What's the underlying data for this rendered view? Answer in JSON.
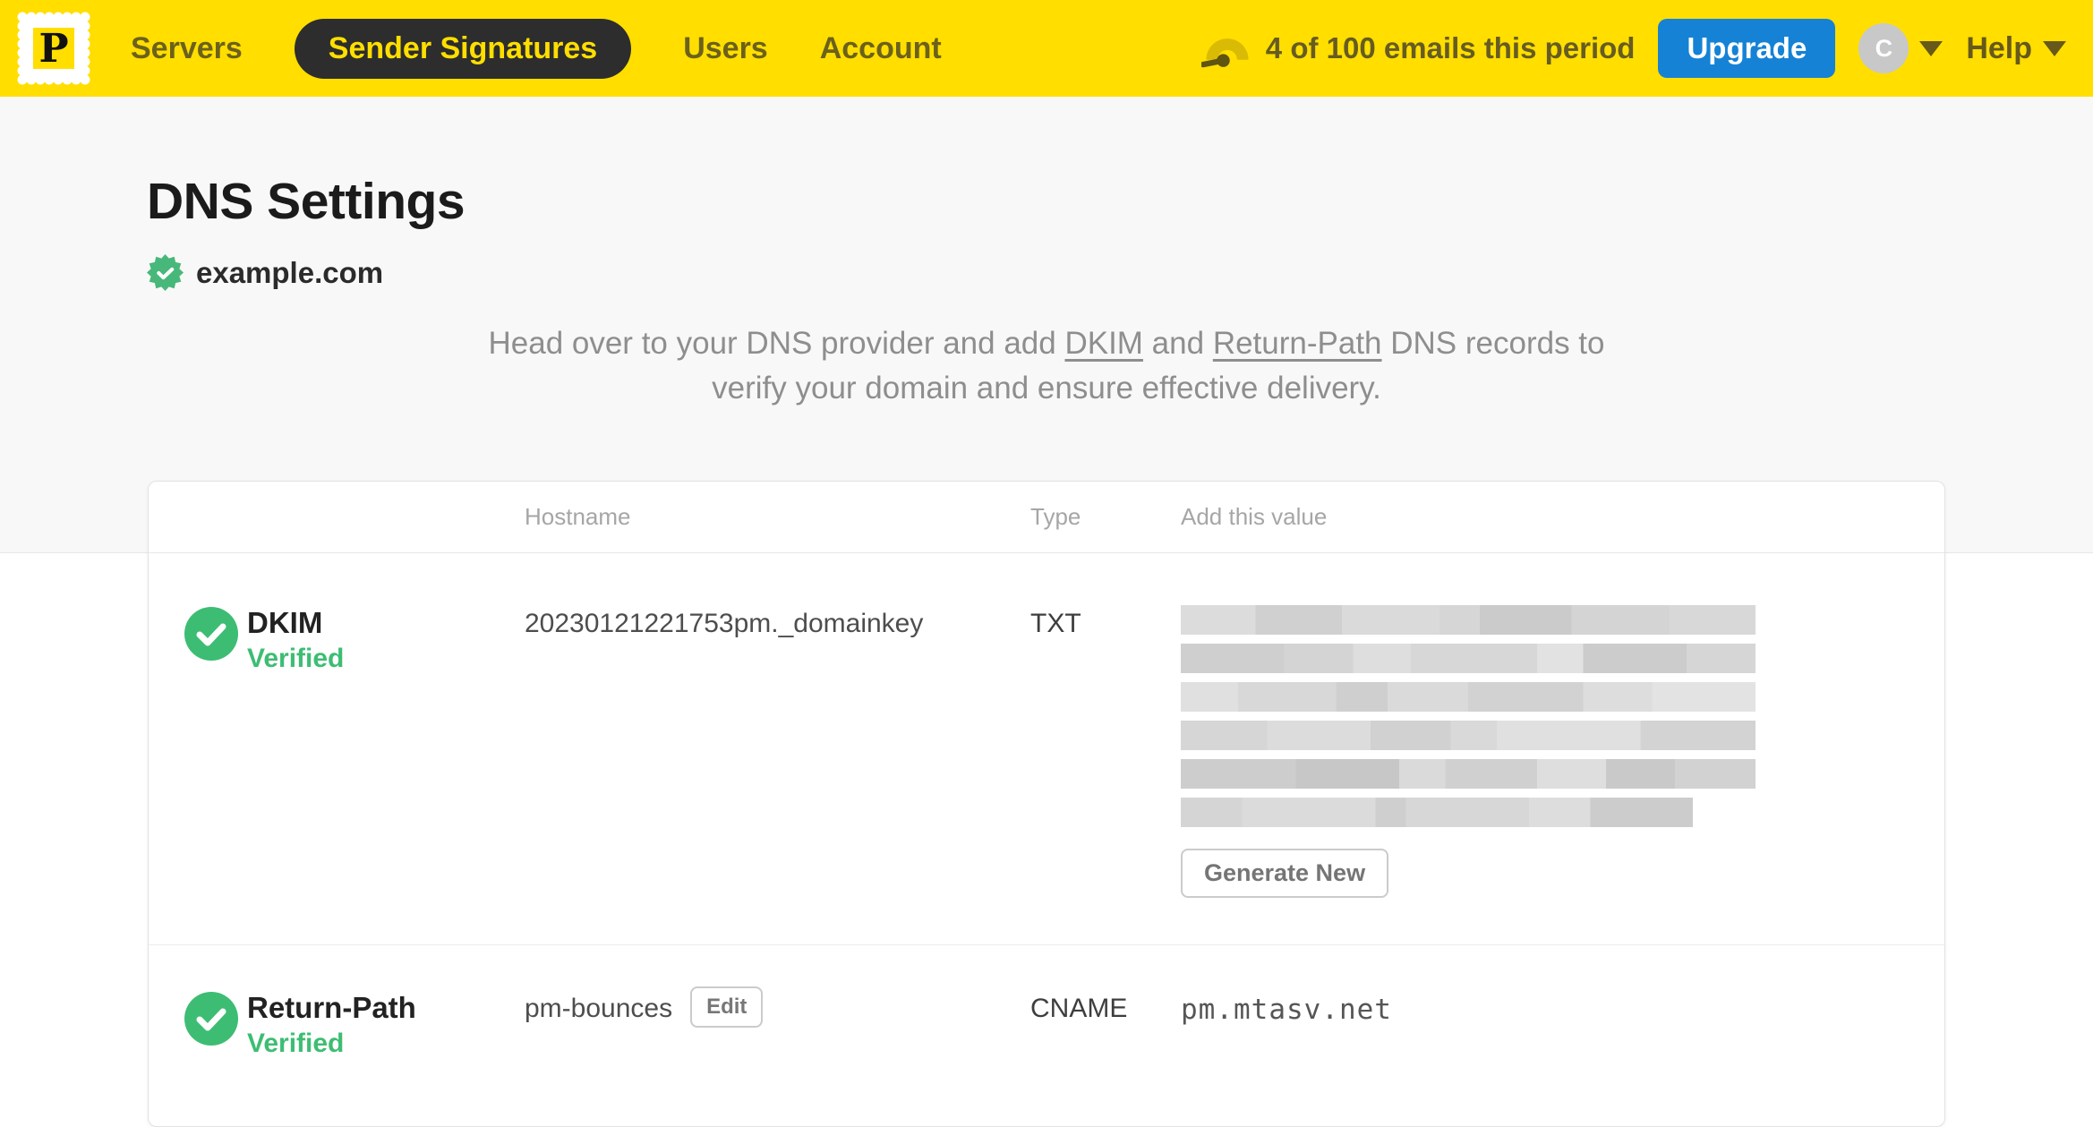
{
  "nav": {
    "logo_letter": "P",
    "items": [
      {
        "label": "Servers",
        "active": false
      },
      {
        "label": "Sender Signatures",
        "active": true
      },
      {
        "label": "Users",
        "active": false
      },
      {
        "label": "Account",
        "active": false
      }
    ],
    "usage_text": "4 of 100 emails this period",
    "upgrade_label": "Upgrade",
    "avatar_initial": "C",
    "help_label": "Help"
  },
  "page": {
    "title": "DNS Settings",
    "domain": "example.com",
    "intro": {
      "p1": "Head over to your DNS provider and add ",
      "link_dkim": "DKIM",
      "p2": " and ",
      "link_return_path": "Return-Path",
      "p3": " DNS records to verify your domain and ensure effective delivery."
    }
  },
  "table": {
    "headers": {
      "hostname": "Hostname",
      "type": "Type",
      "value": "Add this value"
    },
    "rows": [
      {
        "name": "DKIM",
        "status": "Verified",
        "hostname": "20230121221753pm._domainkey",
        "type": "TXT",
        "value_redacted": true,
        "action_label": "Generate New"
      },
      {
        "name": "Return-Path",
        "status": "Verified",
        "hostname": "pm-bounces",
        "edit_label": "Edit",
        "type": "CNAME",
        "value": "pm.mtasv.net"
      }
    ]
  },
  "colors": {
    "brand_yellow": "#FFDE00",
    "upgrade_blue": "#1582D5",
    "verified_green": "#3DBD73"
  }
}
